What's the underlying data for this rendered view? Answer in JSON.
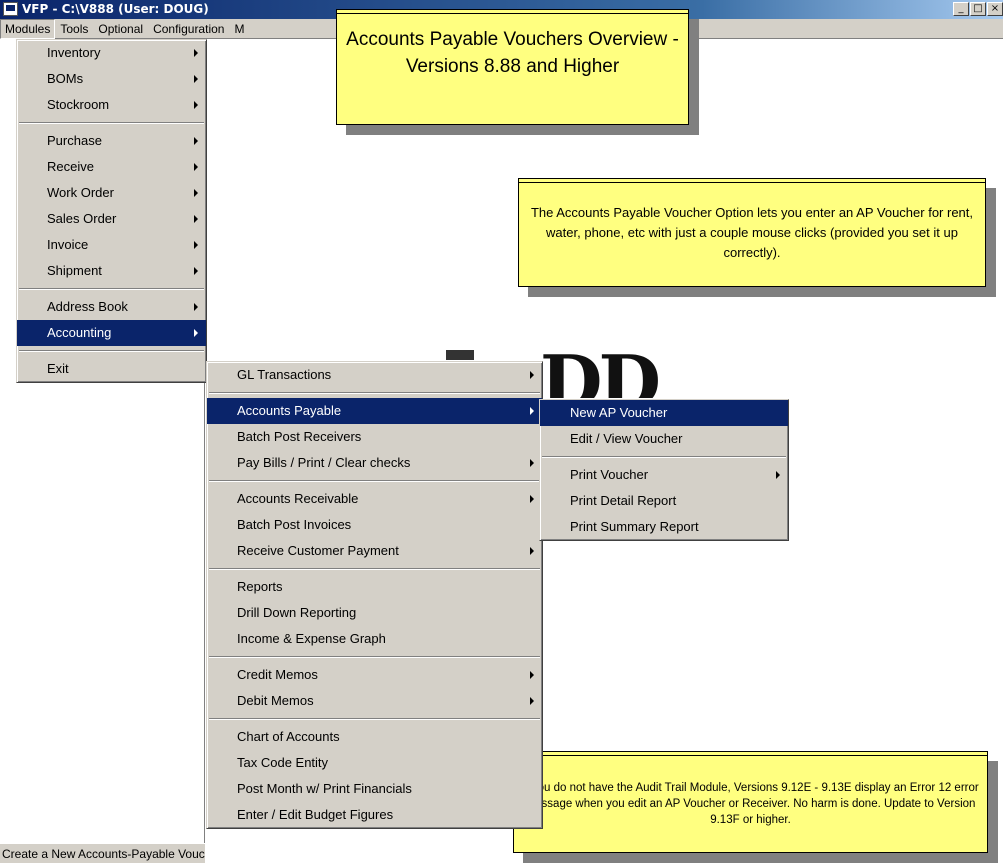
{
  "window": {
    "title": "VFP - C:\\V888  (User: DOUG)",
    "controls": {
      "minimize": "_",
      "maximize": "□",
      "close": "×"
    }
  },
  "menubar": {
    "items": [
      "Modules",
      "Tools",
      "Optional",
      "Configuration",
      "M"
    ]
  },
  "modules_menu": {
    "items": [
      {
        "label": "Inventory",
        "submenu": true
      },
      {
        "label": "BOMs",
        "submenu": true
      },
      {
        "label": "Stockroom",
        "submenu": true
      },
      {
        "label": "Purchase",
        "submenu": true
      },
      {
        "label": "Receive",
        "submenu": true
      },
      {
        "label": "Work Order",
        "submenu": true
      },
      {
        "label": "Sales Order",
        "submenu": true
      },
      {
        "label": "Invoice",
        "submenu": true
      },
      {
        "label": "Shipment",
        "submenu": true
      },
      {
        "label": "Address Book",
        "submenu": true
      },
      {
        "label": "Accounting",
        "submenu": true,
        "selected": true
      },
      {
        "label": "Exit",
        "submenu": false
      }
    ]
  },
  "accounting_menu": {
    "items": [
      {
        "label": "GL Transactions",
        "submenu": true
      },
      {
        "label": "Accounts Payable",
        "submenu": true,
        "selected": true
      },
      {
        "label": "Batch Post Receivers",
        "submenu": false
      },
      {
        "label": "Pay Bills / Print / Clear checks",
        "submenu": true
      },
      {
        "label": "Accounts Receivable",
        "submenu": true
      },
      {
        "label": "Batch Post Invoices",
        "submenu": false
      },
      {
        "label": "Receive Customer Payment",
        "submenu": true
      },
      {
        "label": "Reports",
        "submenu": false
      },
      {
        "label": "Drill Down Reporting",
        "submenu": false
      },
      {
        "label": "Income & Expense Graph",
        "submenu": false
      },
      {
        "label": "Credit Memos",
        "submenu": true
      },
      {
        "label": "Debit Memos",
        "submenu": true
      },
      {
        "label": "Chart of Accounts",
        "submenu": false
      },
      {
        "label": "Tax Code Entity",
        "submenu": false
      },
      {
        "label": "Post Month w/ Print Financials",
        "submenu": false
      },
      {
        "label": "Enter / Edit Budget Figures",
        "submenu": false
      }
    ]
  },
  "ap_menu": {
    "items": [
      {
        "label": "New AP Voucher",
        "submenu": false,
        "selected": true
      },
      {
        "label": "Edit / View Voucher",
        "submenu": false
      },
      {
        "label": "Print Voucher",
        "submenu": true
      },
      {
        "label": "Print Detail Report",
        "submenu": false
      },
      {
        "label": "Print Summary Report",
        "submenu": false
      }
    ]
  },
  "callouts": {
    "title": "Accounts Payable Vouchers Overview - Versions 8.88 and Higher",
    "info": "The Accounts Payable Voucher Option lets you enter an AP Voucher for rent, water, phone, etc with just a couple mouse clicks (provided you set it up  correctly).",
    "note": "If you do not have the Audit Trail Module, Versions 9.12E - 9.13E display an Error 12 error message when you edit an AP Voucher or Receiver.  No harm is done. Update to Version 9.13F or higher."
  },
  "background_logo": "DD",
  "statusbar": {
    "text": "Create a New Accounts-Payable Voucher"
  },
  "colors": {
    "menu_highlight": "#0a246a",
    "menu_face": "#d4d0c8",
    "callout_fill": "#ffff80"
  }
}
